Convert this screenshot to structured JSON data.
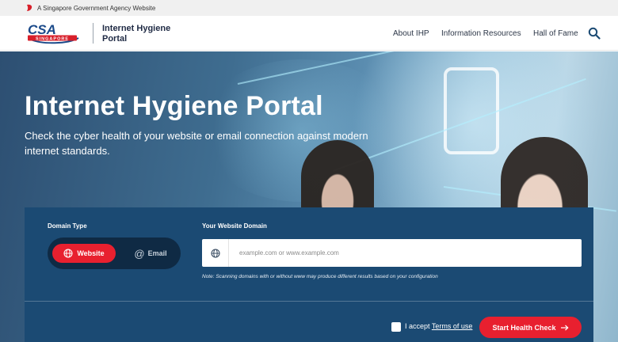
{
  "masthead": {
    "text": "A Singapore Government Agency Website"
  },
  "header": {
    "logo_main": "CSA",
    "logo_sub": "SINGAPORE",
    "portal_name": "Internet Hygiene Portal",
    "nav": [
      {
        "label": "About IHP"
      },
      {
        "label": "Information Resources"
      },
      {
        "label": "Hall of Fame"
      }
    ]
  },
  "hero": {
    "title": "Internet Hygiene Portal",
    "subtitle": "Check the cyber health of your website or email connection against modern internet standards."
  },
  "form": {
    "domain_type_label": "Domain Type",
    "website_option": "Website",
    "email_option": "Email",
    "website_domain_label": "Your Website Domain",
    "domain_placeholder": "example.com or www.example.com",
    "domain_value": "",
    "note": "Note: Scanning domains with or without www may produce different results based on your configuration",
    "accept_prefix": "I accept ",
    "terms_link": "Terms of use",
    "start_button": "Start Health Check"
  },
  "colors": {
    "accent_red": "#e8202f",
    "panel_blue": "#1b4a73",
    "toggle_bg": "#0f2a44",
    "logo_blue": "#1b4a8a"
  },
  "icons": {
    "masthead": "singapore-lion-icon",
    "search": "search-icon",
    "globe": "globe-icon",
    "at": "at-icon",
    "arrow": "arrow-right-icon"
  }
}
